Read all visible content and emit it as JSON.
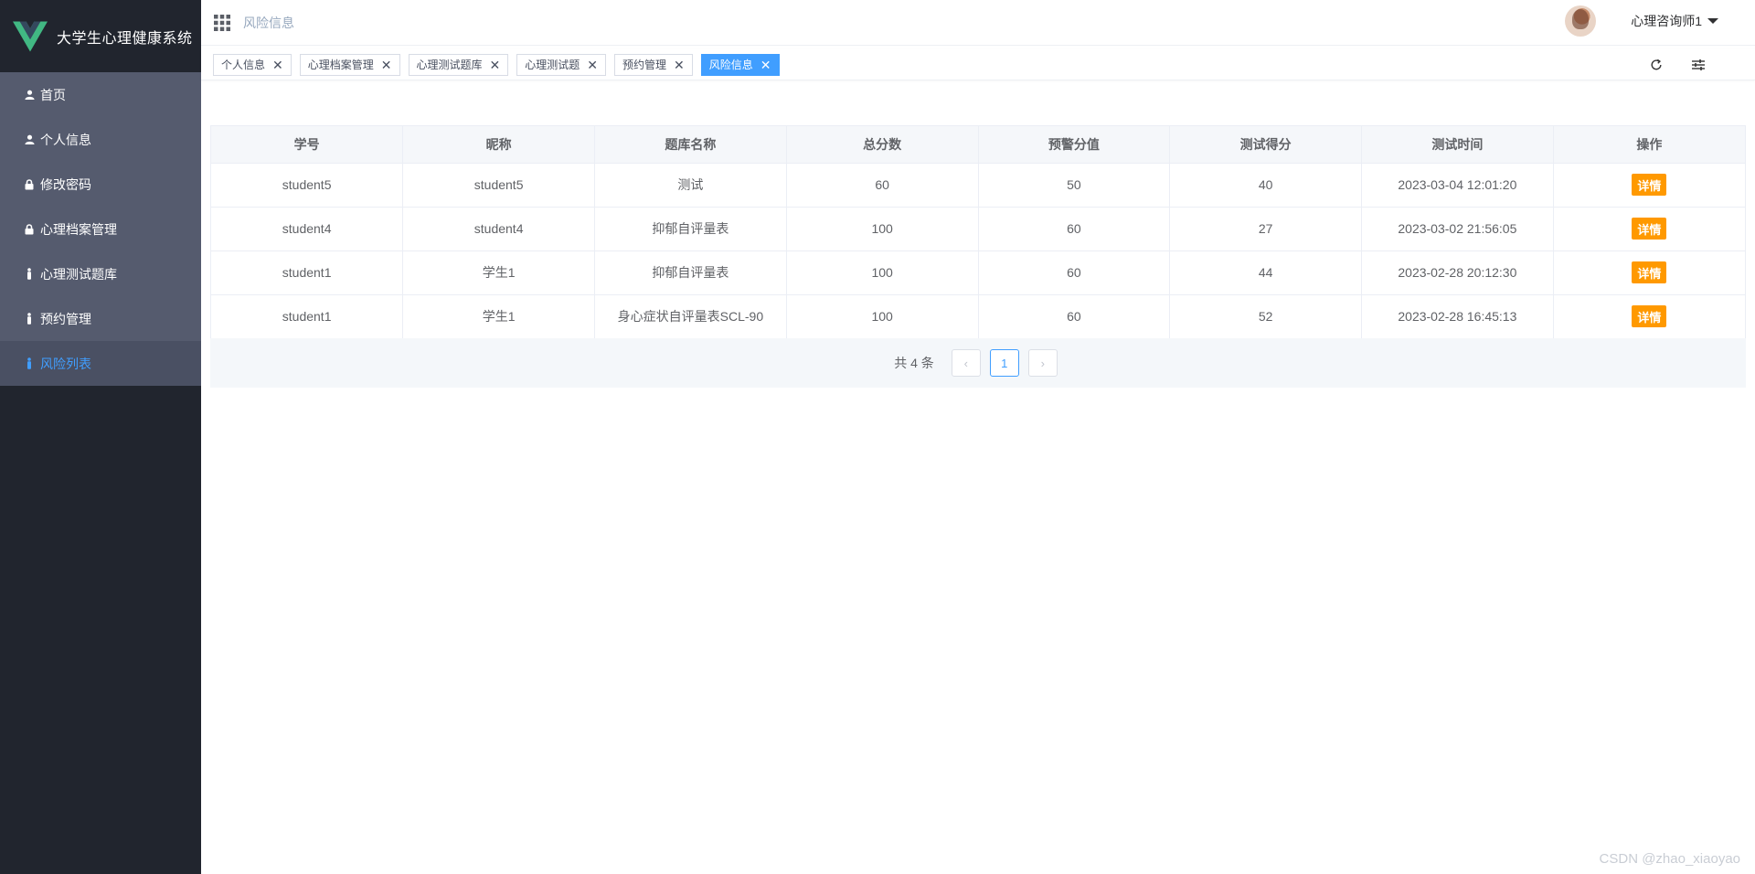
{
  "app": {
    "title": "大学生心理健康系统",
    "brand_color": "#41b883"
  },
  "sidebar": {
    "items": [
      {
        "label": "首页",
        "icon": "user-icon",
        "active": false
      },
      {
        "label": "个人信息",
        "icon": "user-icon",
        "active": false
      },
      {
        "label": "修改密码",
        "icon": "lock-icon",
        "active": false
      },
      {
        "label": "心理档案管理",
        "icon": "lock-icon",
        "active": false
      },
      {
        "label": "心理测试题库",
        "icon": "person-icon",
        "active": false
      },
      {
        "label": "预约管理",
        "icon": "person-icon",
        "active": false
      },
      {
        "label": "风险列表",
        "icon": "person-icon",
        "active": true
      }
    ]
  },
  "header": {
    "breadcrumb": "风险信息",
    "username": "心理咨询师1"
  },
  "tags": [
    {
      "label": "个人信息",
      "active": false
    },
    {
      "label": "心理档案管理",
      "active": false
    },
    {
      "label": "心理测试题库",
      "active": false
    },
    {
      "label": "心理测试题",
      "active": false
    },
    {
      "label": "预约管理",
      "active": false
    },
    {
      "label": "风险信息",
      "active": true
    }
  ],
  "table": {
    "columns": [
      "学号",
      "昵称",
      "题库名称",
      "总分数",
      "预警分值",
      "测试得分",
      "测试时间",
      "操作"
    ],
    "rows": [
      {
        "student_id": "student5",
        "nickname": "student5",
        "bank": "测试",
        "total": "60",
        "warn": "50",
        "score": "40",
        "time": "2023-03-04 12:01:20",
        "action": "详情"
      },
      {
        "student_id": "student4",
        "nickname": "student4",
        "bank": "抑郁自评量表",
        "total": "100",
        "warn": "60",
        "score": "27",
        "time": "2023-03-02 21:56:05",
        "action": "详情"
      },
      {
        "student_id": "student1",
        "nickname": "学生1",
        "bank": "抑郁自评量表",
        "total": "100",
        "warn": "60",
        "score": "44",
        "time": "2023-02-28 20:12:30",
        "action": "详情"
      },
      {
        "student_id": "student1",
        "nickname": "学生1",
        "bank": "身心症状自评量表SCL-90",
        "total": "100",
        "warn": "60",
        "score": "52",
        "time": "2023-02-28 16:45:13",
        "action": "详情"
      }
    ]
  },
  "pagination": {
    "total_text": "共 4 条",
    "prev": "‹",
    "current": "1",
    "next": "›"
  },
  "watermark": "CSDN @zhao_xiaoyao",
  "colors": {
    "sidebar_bg": "#21252e",
    "menu_bg": "#555b6e",
    "accent": "#409eff",
    "detail_button": "#ff9900"
  }
}
